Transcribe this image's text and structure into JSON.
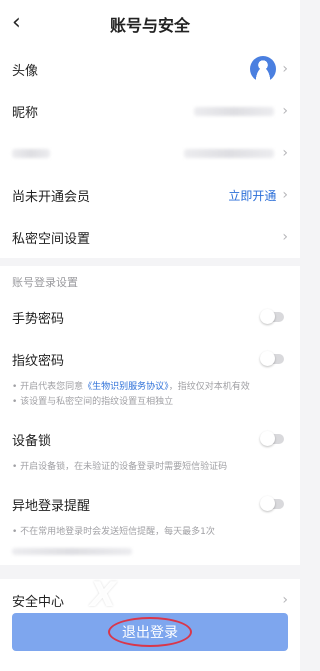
{
  "header": {
    "title": "账号与安全",
    "back_icon": "chevron-left-icon"
  },
  "rows": {
    "avatar_label": "头像",
    "nickname_label": "昵称",
    "member_label": "尚未开通会员",
    "member_action": "立即开通",
    "private_label": "私密空间设置"
  },
  "login_section": {
    "title": "账号登录设置",
    "gesture_label": "手势密码",
    "fingerprint_label": "指纹密码",
    "fingerprint_note_prefix": "• 开启代表您同意",
    "fingerprint_note_link": "《生物识别服务协议》",
    "fingerprint_note_suffix": "，指纹仅对本机有效",
    "fingerprint_note_line2": "• 该设置与私密空间的指纹设置互相独立",
    "device_lock_label": "设备锁",
    "device_lock_note": "• 开启设备锁，在未验证的设备登录时需要短信验证码",
    "remote_login_label": "异地登录提醒",
    "remote_login_note": "• 不在常用地登录时会发送短信提醒，每天最多1次"
  },
  "security_center": "安全中心",
  "logout": "退出登录",
  "watermark": {
    "symbol": "X",
    "text": "自由互联"
  },
  "colors": {
    "accent": "#2c6fd8",
    "logout_bg": "#7ea6ee",
    "highlight_circle": "#d9364a"
  }
}
